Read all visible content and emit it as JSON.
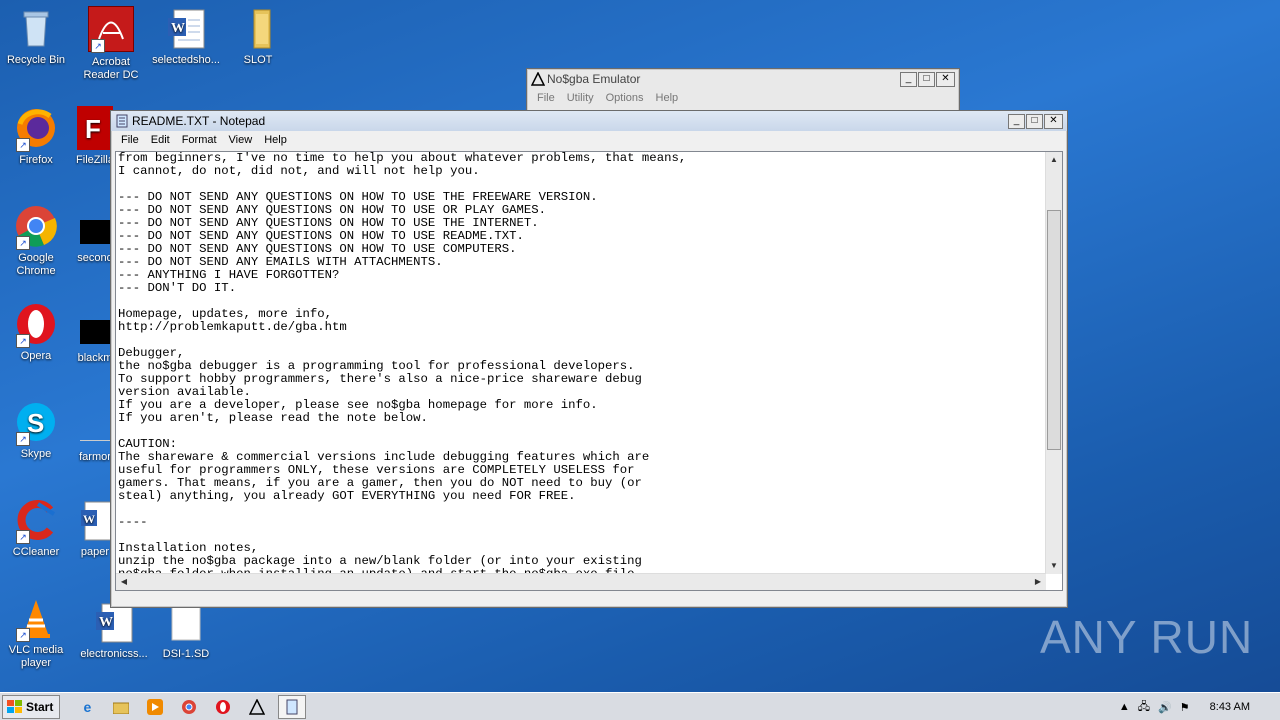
{
  "desktop": {
    "icons": [
      {
        "label": "Recycle Bin",
        "icon": "recycle-bin-icon"
      },
      {
        "label": "Acrobat Reader DC",
        "icon": "acrobat-icon"
      },
      {
        "label": "selectedsho...",
        "icon": "word-doc-icon"
      },
      {
        "label": "SLOT",
        "icon": "folder-icon"
      },
      {
        "label": "Firefox",
        "icon": "firefox-icon"
      },
      {
        "label": "FileZilla",
        "icon": "filezilla-icon"
      },
      {
        "label": "Google Chrome",
        "icon": "chrome-icon"
      },
      {
        "label": "second",
        "icon": "black-file-icon"
      },
      {
        "label": "Opera",
        "icon": "opera-icon"
      },
      {
        "label": "blackm",
        "icon": "black-file-icon"
      },
      {
        "label": "Skype",
        "icon": "skype-icon"
      },
      {
        "label": "farmor",
        "icon": "file-icon"
      },
      {
        "label": "CCleaner",
        "icon": "ccleaner-icon"
      },
      {
        "label": "paper",
        "icon": "word-doc-icon"
      },
      {
        "label": "VLC media player",
        "icon": "vlc-icon"
      },
      {
        "label": "electronicss...",
        "icon": "word-doc-icon"
      },
      {
        "label": "DSI-1.SD",
        "icon": "blank-file-icon"
      }
    ],
    "watermark": "ANY RUN"
  },
  "emulator": {
    "title": "No$gba Emulator",
    "menu": [
      "File",
      "Utility",
      "Options",
      "Help"
    ]
  },
  "notepad": {
    "title": "README.TXT - Notepad",
    "menu": [
      "File",
      "Edit",
      "Format",
      "View",
      "Help"
    ],
    "text": "from beginners, I've no time to help you about whatever problems, that means,\nI cannot, do not, did not, and will not help you.\n\n--- DO NOT SEND ANY QUESTIONS ON HOW TO USE THE FREEWARE VERSION.\n--- DO NOT SEND ANY QUESTIONS ON HOW TO USE OR PLAY GAMES.\n--- DO NOT SEND ANY QUESTIONS ON HOW TO USE THE INTERNET.\n--- DO NOT SEND ANY QUESTIONS ON HOW TO USE README.TXT.\n--- DO NOT SEND ANY QUESTIONS ON HOW TO USE COMPUTERS.\n--- DO NOT SEND ANY EMAILS WITH ATTACHMENTS.\n--- ANYTHING I HAVE FORGOTTEN?\n--- DON'T DO IT.\n\nHomepage, updates, more info,\nhttp://problemkaputt.de/gba.htm\n\nDebugger,\nthe no$gba debugger is a programming tool for professional developers.\nTo support hobby programmers, there's also a nice-price shareware debug\nversion available.\nIf you are a developer, please see no$gba homepage for more info.\nIf you aren't, please read the note below.\n\nCAUTION:\nThe shareware & commercial versions include debugging features which are\nuseful for programmers ONLY, these versions are COMPLETELY USELESS for\ngamers. That means, if you are a gamer, then you do NOT need to buy (or\nsteal) anything, you already GOT EVERYTHING you need FOR FREE.\n\n----\n\nInstallation notes,\nunzip the no$gba package into a new/blank folder (or into your existing\nno$gba folder when installing an update) and start the no$gba.exe file."
  },
  "taskbar": {
    "start_label": "Start",
    "clock": "8:43 AM"
  }
}
